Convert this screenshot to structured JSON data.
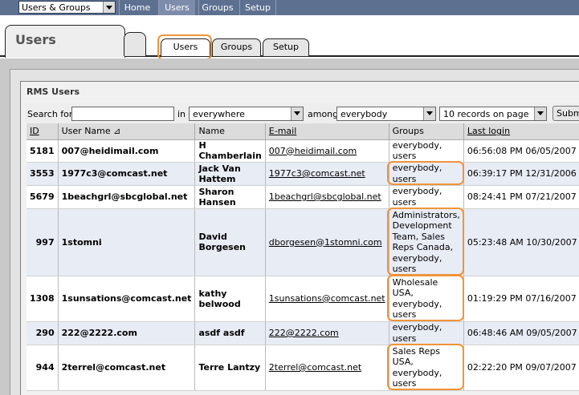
{
  "topbar": {
    "section_select": "Users & Groups",
    "nav": [
      "Home",
      "Users",
      "Groups",
      "Setup"
    ],
    "active_nav": "Users"
  },
  "tabs": {
    "title": "Users",
    "sub": [
      "Users",
      "Groups",
      "Setup"
    ],
    "active_sub": "Users"
  },
  "panel": {
    "title": "RMS Users"
  },
  "search": {
    "label_for": "Search for",
    "value": "",
    "label_in": "in",
    "in_value": "everywhere",
    "label_among": "among",
    "among_value": "everybody",
    "page_size": "10 records on page",
    "submit_label": "Subm"
  },
  "table": {
    "headers": {
      "id": "ID",
      "username": "User Name",
      "sort_indicator": "⊿",
      "name": "Name",
      "email": "E-mail",
      "groups": "Groups",
      "last_login": "Last login"
    },
    "rows": [
      {
        "id": "5181",
        "username": "007@heidimail.com",
        "name": "H Chamberlain",
        "email": "007@heidimail.com",
        "groups": [
          "everybody,",
          "users"
        ],
        "last_login": "06:56:08 PM 06/05/2007",
        "highlight": false
      },
      {
        "id": "3553",
        "username": "1977c3@comcast.net",
        "name": "Jack Van Hattem",
        "email": "1977c3@comcast.net",
        "groups": [
          "everybody,",
          "users"
        ],
        "last_login": "06:39:17 PM 12/31/2006",
        "highlight": true
      },
      {
        "id": "5679",
        "username": "1beachgrl@sbcglobal.net",
        "name": "Sharon Hansen",
        "email": "1beachgrl@sbcglobal.net",
        "groups": [
          "everybody,",
          "users"
        ],
        "last_login": "08:24:41 PM 07/21/2007",
        "highlight": false
      },
      {
        "id": "997",
        "username": "1stomni",
        "name": "David Borgesen",
        "email": "dborgesen@1stomni.com",
        "groups": [
          "Administrators,",
          "Development",
          "Team, Sales",
          "Reps Canada,",
          "everybody,",
          "users"
        ],
        "last_login": "05:23:48 AM 10/30/2007",
        "highlight": true
      },
      {
        "id": "1308",
        "username": "1sunsations@comcast.net",
        "name": "kathy belwood",
        "email": "1sunsations@comcast.net",
        "groups": [
          "Wholesale",
          "USA,",
          "everybody,",
          "users"
        ],
        "last_login": "01:19:29 PM 07/16/2007",
        "highlight": true
      },
      {
        "id": "290",
        "username": "222@2222.com",
        "name": "asdf asdf",
        "email": "222@2222.com",
        "groups": [
          "everybody,",
          "users"
        ],
        "last_login": "06:48:46 AM 09/05/2007",
        "highlight": false
      },
      {
        "id": "944",
        "username": "2terrel@comcast.net",
        "name": "Terre Lantzy",
        "email": "2terrel@comcast.net",
        "groups": [
          "Sales Reps",
          "USA,",
          "everybody,",
          "users"
        ],
        "last_login": "02:22:20 PM 09/07/2007",
        "highlight": true
      }
    ]
  },
  "colors": {
    "topbar": "#5e7090",
    "highlight": "#f0943a",
    "row_alt": "#e8ecf5"
  }
}
